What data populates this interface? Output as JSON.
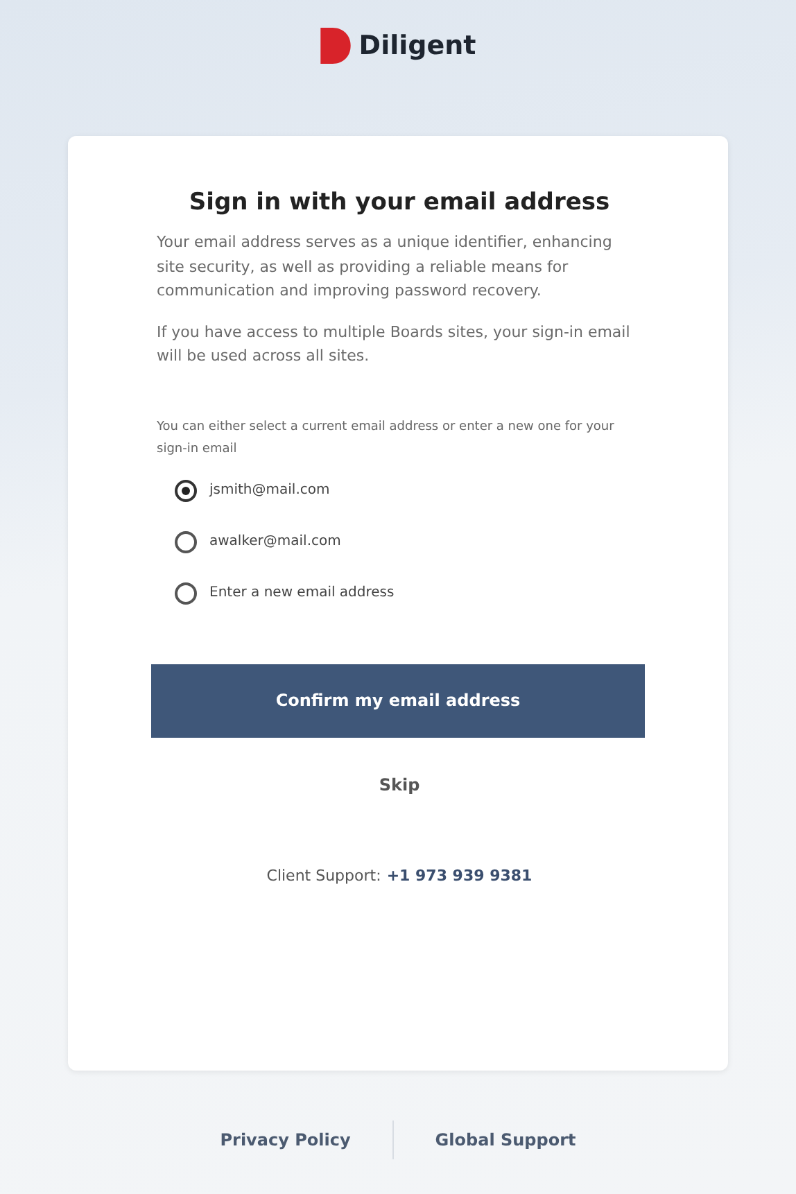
{
  "logo": {
    "text": "Diligent"
  },
  "card": {
    "title": "Sign in with your email address",
    "paragraphs": [
      "Your email address serves as a unique identifier, enhancing site security, as well as providing a reliable means for communication and improving password recovery.",
      "If you have access to multiple Boards sites, your sign-in email will be used across all sites."
    ],
    "prompt": "You can either select a current email address or enter a new one for your sign-in email",
    "options": [
      {
        "label": "jsmith@mail.com",
        "selected": true
      },
      {
        "label": "awalker@mail.com",
        "selected": false
      },
      {
        "label": "Enter a new email address",
        "selected": false
      }
    ],
    "confirm_button": "Confirm my email address",
    "skip_link": "Skip",
    "support": {
      "label": "Client Support:",
      "phone": "+1 973 939 9381"
    }
  },
  "footer_links": [
    "Privacy Policy",
    "Global Support"
  ]
}
